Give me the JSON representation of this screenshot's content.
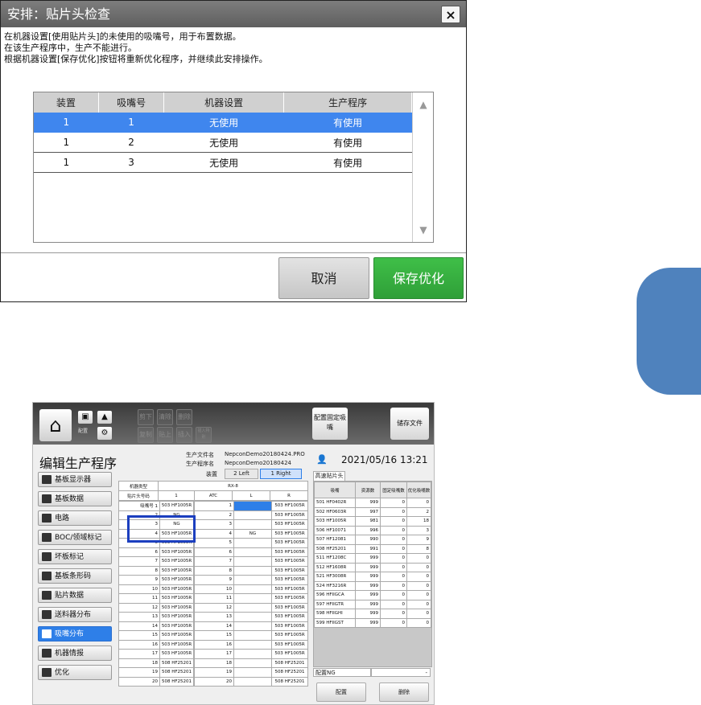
{
  "dialog": {
    "title": "安排：贴片头检查",
    "close_label": "×",
    "message_lines": [
      "在机器设置[使用贴片头]的未使用的吸嘴号，用于布置数据。",
      "在该生产程序中，生产不能进行。",
      "根据机器设置[保存优化]按钮将重新优化程序，并继续此安排操作。"
    ],
    "table": {
      "headers": [
        "装置",
        "吸嘴号",
        "机器设置",
        "生产程序"
      ],
      "rows": [
        [
          "1",
          "1",
          "无使用",
          "有使用"
        ],
        [
          "1",
          "2",
          "无使用",
          "有使用"
        ],
        [
          "1",
          "3",
          "无使用",
          "有使用"
        ]
      ]
    },
    "scroll_up_icon": "▲",
    "scroll_down_icon": "▼",
    "cancel_label": "取消",
    "save_label": "保存优化"
  },
  "colors": {
    "accent_blue": "#3f86ee",
    "save_green": "#35ad3e",
    "side_tab": "#4f82bd",
    "highlight_box": "#1c3fbf"
  },
  "app": {
    "toolbar": {
      "home_icon": "⌂",
      "caption_left": "配置",
      "cut": "剪下",
      "clear": "清除",
      "delete": "删除",
      "copy": "复制",
      "paste": "贴上",
      "insert": "插入",
      "insert_special": "插入特别",
      "fixed_nozzle": "配置固定吸嘴",
      "save_file": "储存文件"
    },
    "header": {
      "title": "编辑生产程序",
      "prod_file_label": "生产文件名",
      "prod_file": "NepconDemo20180424.PRO",
      "prod_prog_label": "生产程序名",
      "prod_prog": "NepconDemo20180424",
      "device_label": "装置",
      "left_tab": "2 Left",
      "right_tab": "1 Right",
      "datetime": "2021/05/16 13:21"
    },
    "sidebar": [
      "基板显示器",
      "基板数据",
      "电路",
      "BOC/领域标记",
      "坏板标记",
      "基板条形码",
      "贴片数据",
      "送料器分布",
      "吸嘴分布",
      "机器情报",
      "优化"
    ],
    "machine": {
      "type_label": "机器类型",
      "type_value": "RX-8",
      "head_no_label": "贴片头号码",
      "head_no_value": "1",
      "col_atc": "ATC",
      "col_l": "L",
      "col_r": "R",
      "nozzle_label": "吸嘴号码",
      "left_rows": [
        [
          "吸嘴号 1",
          "503 HF1005R"
        ],
        [
          "2",
          "NG"
        ],
        [
          "3",
          "NG"
        ],
        [
          "4",
          "503 HF1005R"
        ],
        [
          "5",
          "503 HF1005R"
        ],
        [
          "6",
          "503 HF1005R"
        ],
        [
          "7",
          "503 HF1005R"
        ],
        [
          "8",
          "503 HF1005R"
        ],
        [
          "9",
          "503 HF1005R"
        ],
        [
          "10",
          "503 HF1005R"
        ],
        [
          "11",
          "503 HF1005R"
        ],
        [
          "12",
          "503 HF1005R"
        ],
        [
          "13",
          "503 HF1005R"
        ],
        [
          "14",
          "503 HF1005R"
        ],
        [
          "15",
          "503 HF1005R"
        ],
        [
          "16",
          "503 HF1005R"
        ],
        [
          "17",
          "503 HF1005R"
        ],
        [
          "18",
          "508 HF25201"
        ],
        [
          "19",
          "508 HF25201"
        ],
        [
          "20",
          "508 HF25201"
        ]
      ],
      "atc_rows": [
        [
          "1",
          "",
          "503 HF1005R"
        ],
        [
          "2",
          "",
          "503 HF1005R"
        ],
        [
          "3",
          "",
          "503 HF1005R"
        ],
        [
          "4",
          "NG",
          "503 HF1005R"
        ],
        [
          "5",
          "",
          "503 HF1005R"
        ],
        [
          "6",
          "",
          "503 HF1005R"
        ],
        [
          "7",
          "",
          "503 HF1005R"
        ],
        [
          "8",
          "",
          "503 HF1005R"
        ],
        [
          "9",
          "",
          "503 HF1005R"
        ],
        [
          "10",
          "",
          "503 HF1005R"
        ],
        [
          "11",
          "",
          "503 HF1005R"
        ],
        [
          "12",
          "",
          "503 HF1005R"
        ],
        [
          "13",
          "",
          "503 HF1005R"
        ],
        [
          "14",
          "",
          "503 HF1005R"
        ],
        [
          "15",
          "",
          "503 HF1005R"
        ],
        [
          "16",
          "",
          "503 HF1005R"
        ],
        [
          "17",
          "",
          "503 HF1005R"
        ],
        [
          "18",
          "",
          "508 HF25201"
        ],
        [
          "19",
          "",
          "508 HF25201"
        ],
        [
          "20",
          "",
          "508 HF25201"
        ]
      ]
    },
    "right_panel": {
      "tab": "高速贴片头",
      "headers": [
        "吸嘴",
        "资源数",
        "固定吸嘴数",
        "优化吸嘴数"
      ],
      "rows": [
        [
          "501 HF0402R",
          "999",
          "0",
          "0"
        ],
        [
          "502 HF0603R",
          "997",
          "0",
          "2"
        ],
        [
          "503 HF1005R",
          "981",
          "0",
          "18"
        ],
        [
          "506 HF10071",
          "996",
          "0",
          "3"
        ],
        [
          "507 HF12081",
          "990",
          "0",
          "9"
        ],
        [
          "508 HF25201",
          "991",
          "0",
          "8"
        ],
        [
          "511 HF1208C",
          "999",
          "0",
          "0"
        ],
        [
          "512 HF1608R",
          "999",
          "0",
          "0"
        ],
        [
          "521 HF3008R",
          "999",
          "0",
          "0"
        ],
        [
          "524 HF3216R",
          "999",
          "0",
          "0"
        ],
        [
          "596 HFIIGCA",
          "999",
          "0",
          "0"
        ],
        [
          "597 HFIIGTR",
          "999",
          "0",
          "0"
        ],
        [
          "598 HFIIGHI",
          "999",
          "0",
          "0"
        ],
        [
          "599 HFIIGST",
          "999",
          "0",
          "0"
        ]
      ],
      "ng_label": "配置NG",
      "ng_value": "-",
      "btn_place": "配置",
      "btn_delete": "删除"
    }
  }
}
